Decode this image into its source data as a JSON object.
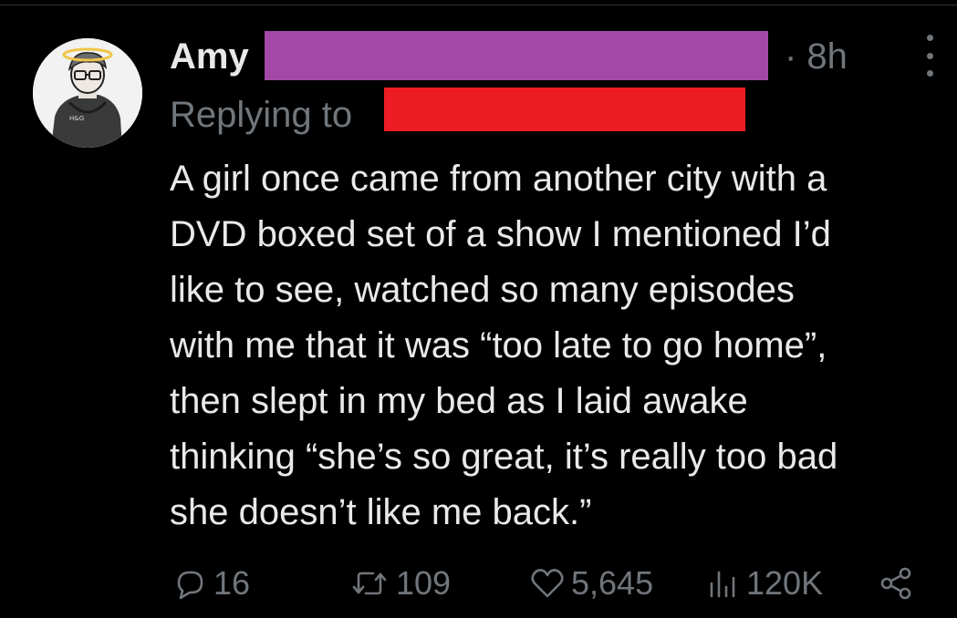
{
  "tweet": {
    "author_name": "Amy",
    "time_label": "· 8h",
    "replying_label": "Replying to",
    "body_lines": [
      "A girl once came from another city with a",
      "DVD boxed set of a show I mentioned I’d",
      "like to see, watched so many episodes",
      "with me that it was “too late to go home”,",
      "then slept in my bed as I laid awake",
      "thinking “she’s so great, it’s really too bad",
      "she doesn’t like me back.”"
    ],
    "avatar_badge": "H&G"
  },
  "actions": {
    "replies": "16",
    "retweets": "109",
    "likes": "5,645",
    "views": "120K"
  },
  "colors": {
    "background": "#000000",
    "text": "#e7e9ea",
    "muted": "#71767b",
    "redaction_name": "#a348a6",
    "redaction_reply": "#ed1c24"
  },
  "icons": {
    "reply": "speech-bubble-icon",
    "retweet": "retweet-arrows-icon",
    "like": "heart-icon",
    "views": "bar-chart-icon",
    "share": "share-icon",
    "more": "more-options-icon"
  }
}
